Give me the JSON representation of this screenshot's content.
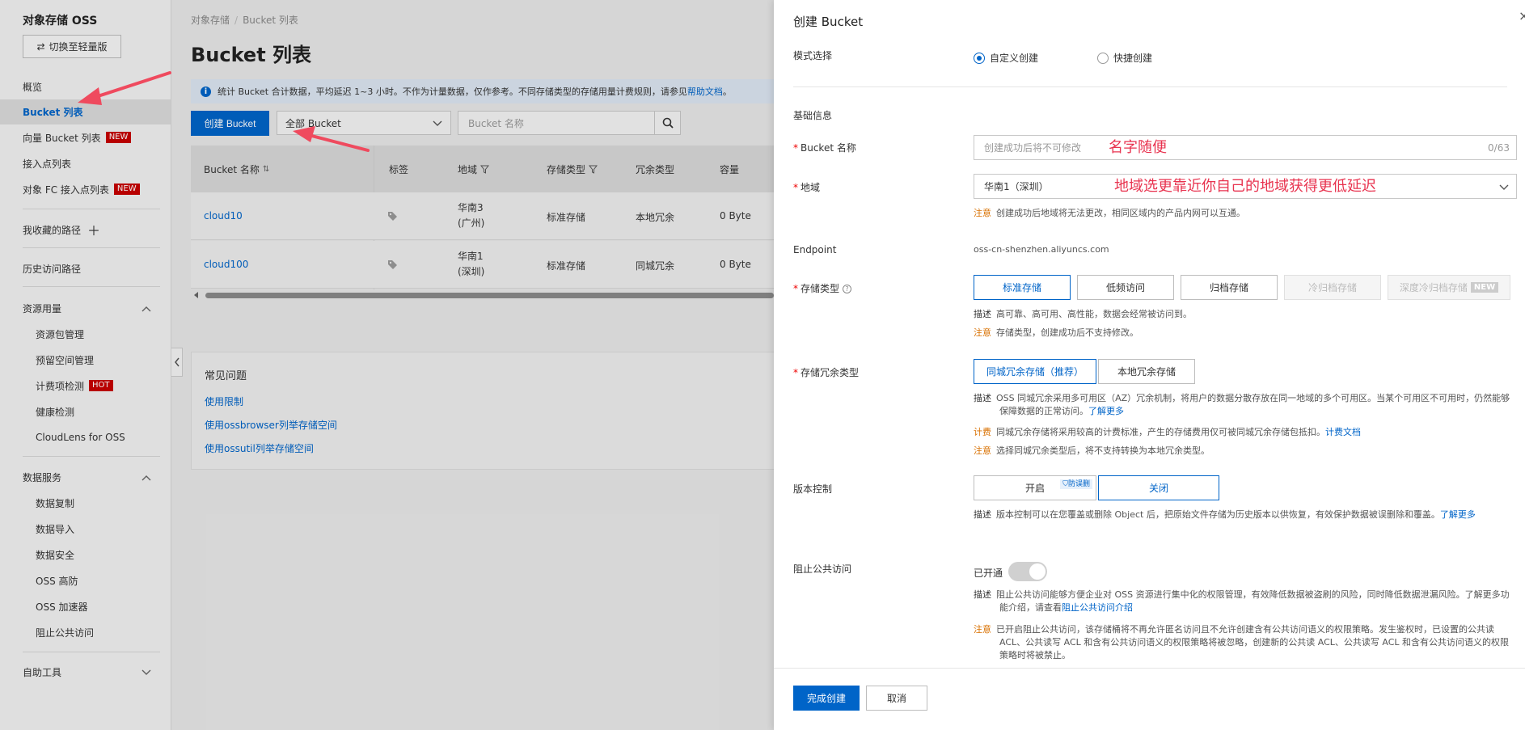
{
  "sidebar": {
    "title": "对象存储 OSS",
    "switch_button": "切换至轻量版",
    "items": [
      {
        "label": "概览"
      },
      {
        "label": "Bucket 列表"
      },
      {
        "label": "向量 Bucket 列表",
        "badge": "NEW"
      },
      {
        "label": "接入点列表"
      },
      {
        "label": "对象 FC 接入点列表",
        "badge": "NEW"
      },
      {
        "label": "我收藏的路径"
      },
      {
        "label": "历史访问路径"
      }
    ],
    "resource_group": {
      "label": "资源用量",
      "items": [
        "资源包管理",
        "预留空间管理",
        "计费项检测",
        "健康检测",
        "CloudLens for OSS"
      ],
      "hot_badge": "HOT"
    },
    "data_group": {
      "label": "数据服务",
      "items": [
        "数据复制",
        "数据导入",
        "数据安全",
        "OSS 高防",
        "OSS 加速器",
        "阻止公共访问"
      ]
    },
    "tools_group": {
      "label": "自助工具"
    }
  },
  "main": {
    "breadcrumb": [
      "对象存储",
      "Bucket 列表"
    ],
    "title": "Bucket 列表",
    "notice_text": "统计 Bucket 合计数据，平均延迟 1~3 小时。不作为计量数据，仅作参考。不同存储类型的存储用量计费规则，请参见",
    "notice_link": "帮助文档",
    "notice_tail": "。",
    "create_button": "创建 Bucket",
    "filter_select": "全部 Bucket",
    "search_placeholder": "Bucket 名称",
    "table": {
      "headers": [
        "Bucket 名称",
        "标签",
        "地域",
        "存储类型",
        "冗余类型",
        "容量"
      ],
      "rows": [
        {
          "name": "cloud10",
          "region_l1": "华南3",
          "region_l2": "(广州)",
          "storage": "标准存储",
          "redundancy": "本地冗余",
          "size": "0 Byte"
        },
        {
          "name": "cloud100",
          "region_l1": "华南1",
          "region_l2": "(深圳)",
          "storage": "标准存储",
          "redundancy": "同城冗余",
          "size": "0 Byte"
        }
      ]
    },
    "faq": {
      "title": "常见问题",
      "links": [
        "使用限制",
        "使用ossbrowser列举存储空间",
        "使用ossutil列举存储空间"
      ]
    }
  },
  "drawer": {
    "title": "创建 Bucket",
    "mode_label": "模式选择",
    "mode_custom": "自定义创建",
    "mode_quick": "快捷创建",
    "basic_info": "基础信息",
    "name_label": "Bucket 名称",
    "name_placeholder": "创建成功后将不可修改",
    "name_count": "0/63",
    "name_annotation": "名字随便",
    "region_label": "地域",
    "region_value": "华南1（深圳）",
    "region_annotation": "地域选更靠近你自己的地域获得更低延迟",
    "region_note_key": "注意",
    "region_note": "创建成功后地域将无法更改，相同区域内的产品内网可以互通。",
    "endpoint_label": "Endpoint",
    "endpoint_value": "oss-cn-shenzhen.aliyuncs.com",
    "storage_label": "存储类型",
    "storage_options": [
      "标准存储",
      "低频访问",
      "归档存储",
      "冷归档存储",
      "深度冷归档存储"
    ],
    "storage_new_badge": "NEW",
    "storage_desc_key": "描述",
    "storage_desc": "高可靠、高可用、高性能，数据会经常被访问到。",
    "storage_note_key": "注意",
    "storage_note": "存储类型，创建成功后不支持修改。",
    "redundancy_label": "存储冗余类型",
    "redundancy_options": [
      "同城冗余存储（推荐）",
      "本地冗余存储"
    ],
    "redundancy_desc_key": "描述",
    "redundancy_desc": "OSS 同城冗余采用多可用区（AZ）冗余机制，将用户的数据分散存放在同一地域的多个可用区。当某个可用区不可用时，仍然能够保障数据的正常访问。",
    "redundancy_desc_link": "了解更多",
    "redundancy_bill_key": "计费",
    "redundancy_bill": "同城冗余存储将采用较高的计费标准，产生的存储费用仅可被同城冗余存储包抵扣。",
    "redundancy_bill_link": "计费文档",
    "redundancy_note_key": "注意",
    "redundancy_note": "选择同城冗余类型后，将不支持转换为本地冗余类型。",
    "version_label": "版本控制",
    "version_on": "开启",
    "version_anti": "防误删",
    "version_off": "关闭",
    "version_desc_key": "描述",
    "version_desc": "版本控制可以在您覆盖或删除 Object 后，把原始文件存储为历史版本以供恢复，有效保护数据被误删除和覆盖。",
    "version_desc_link": "了解更多",
    "block_label": "阻止公共访问",
    "block_status": "已开通",
    "block_desc_key": "描述",
    "block_desc": "阻止公共访问能够方便企业对 OSS 资源进行集中化的权限管理，有效降低数据被盗刷的风险，同时降低数据泄漏风险。了解更多功能介绍，请查看",
    "block_desc_link": "阻止公共访问介绍",
    "block_note_key": "注意",
    "block_note": "已开启阻止公共访问，该存储桶将不再允许匿名访问且不允许创建含有公共访问语义的权限策略。发生鉴权时，已设置的公共读 ACL、公共读写 ACL 和含有公共访问语义的权限策略将被忽略，创建新的公共读 ACL、公共读写 ACL 和含有公共访问语义的权限策略时将被禁止。",
    "confirm_button": "完成创建",
    "cancel_button": "取消"
  },
  "colors": {
    "primary": "#0064c8",
    "annotation": "#e8334f",
    "warn": "#d97000",
    "badge_red": "#c80000"
  }
}
